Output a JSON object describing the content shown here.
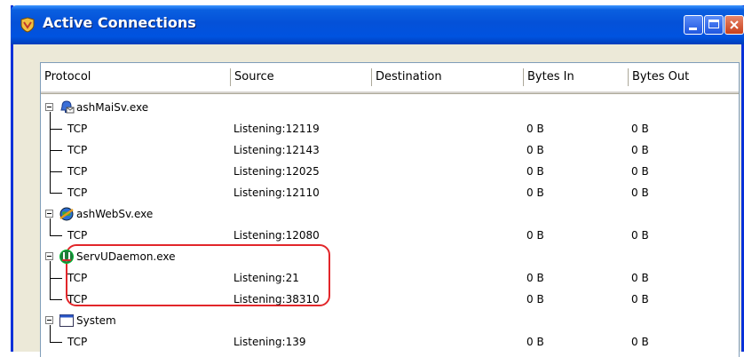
{
  "window": {
    "title": "Active Connections",
    "buttons": {
      "minimize_icon": "minimize-icon",
      "maximize_icon": "maximize-icon",
      "close_icon": "close-icon"
    }
  },
  "columns": [
    "Protocol",
    "Source",
    "Destination",
    "Bytes In",
    "Bytes Out"
  ],
  "groups": [
    {
      "name": "ashMaiSv.exe",
      "icon": "mail-bell-icon",
      "rows": [
        {
          "protocol": "TCP",
          "source": "Listening:12119",
          "destination": "",
          "bytes_in": "0 B",
          "bytes_out": "0 B"
        },
        {
          "protocol": "TCP",
          "source": "Listening:12143",
          "destination": "",
          "bytes_in": "0 B",
          "bytes_out": "0 B"
        },
        {
          "protocol": "TCP",
          "source": "Listening:12025",
          "destination": "",
          "bytes_in": "0 B",
          "bytes_out": "0 B"
        },
        {
          "protocol": "TCP",
          "source": "Listening:12110",
          "destination": "",
          "bytes_in": "0 B",
          "bytes_out": "0 B"
        }
      ]
    },
    {
      "name": "ashWebSv.exe",
      "icon": "web-globe-icon",
      "rows": [
        {
          "protocol": "TCP",
          "source": "Listening:12080",
          "destination": "",
          "bytes_in": "0 B",
          "bytes_out": "0 B"
        }
      ]
    },
    {
      "name": "ServUDaemon.exe",
      "icon": "servu-icon",
      "highlighted": true,
      "rows": [
        {
          "protocol": "TCP",
          "source": "Listening:21",
          "destination": "",
          "bytes_in": "0 B",
          "bytes_out": "0 B"
        },
        {
          "protocol": "TCP",
          "source": "Listening:38310",
          "destination": "",
          "bytes_in": "0 B",
          "bytes_out": "0 B"
        }
      ]
    },
    {
      "name": "System",
      "icon": "system-window-icon",
      "rows": [
        {
          "protocol": "TCP",
          "source": "Listening:139",
          "destination": "",
          "bytes_in": "0 B",
          "bytes_out": "0 B"
        }
      ]
    }
  ],
  "colors": {
    "titlebar": "#0451d8",
    "highlight": "#e2262a",
    "window_bg": "#ece9d8"
  }
}
